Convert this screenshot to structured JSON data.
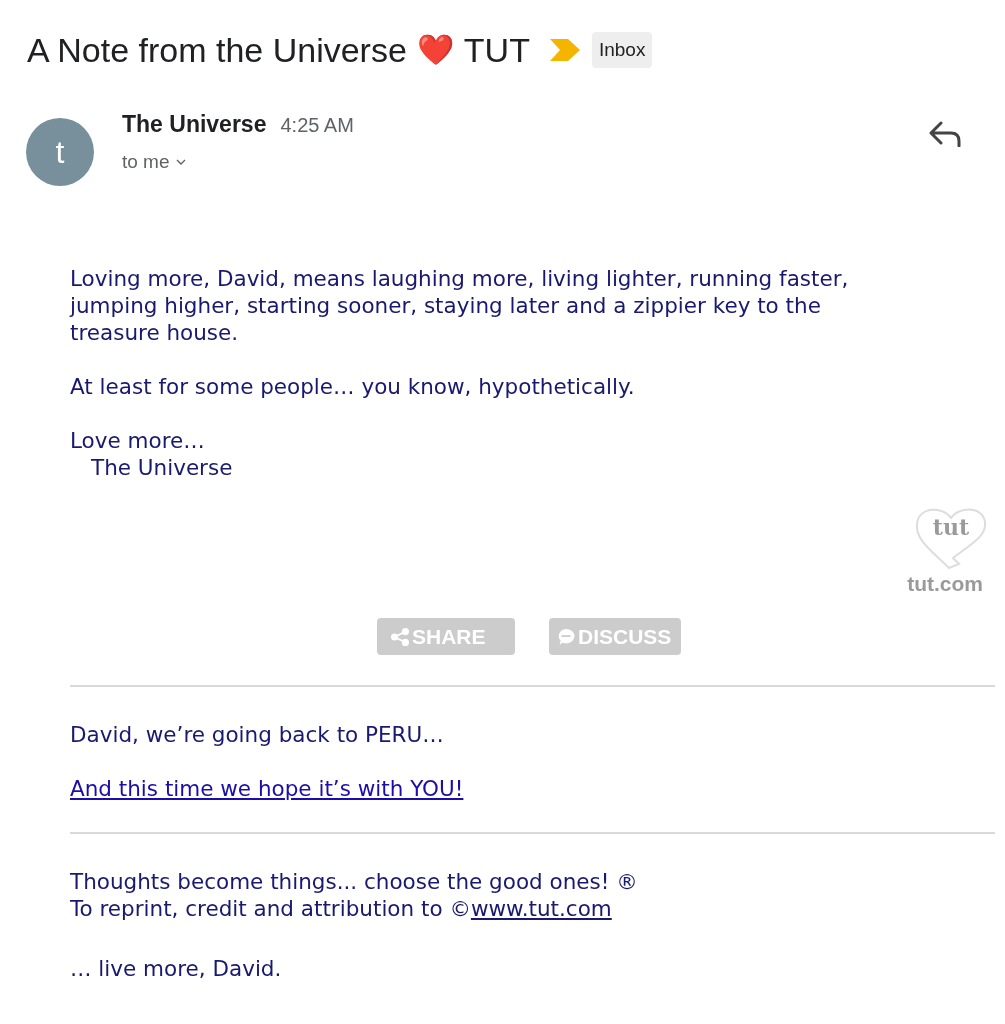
{
  "subject": {
    "title": "A Note from the Universe",
    "emoji": "❤️",
    "suffix": "TUT",
    "important": true,
    "label": "Inbox"
  },
  "message": {
    "avatar_letter": "t",
    "sender": "The Universe",
    "time": "4:25 AM",
    "recipient": "to me"
  },
  "body": {
    "paragraphs": [
      {
        "lines": [
          "Loving more, David, means laughing more, living lighter, running faster,",
          "jumping higher, starting sooner, staying later and a zippier key to the",
          "treasure house."
        ]
      },
      {
        "lines": [
          "At least for some people… you know, hypothetically."
        ]
      }
    ],
    "closing": "Love more…",
    "signature": "The Universe",
    "logo": {
      "mark": "tut",
      "caption": "tut.com"
    },
    "actions": [
      {
        "kind": "share",
        "label": "SHARE"
      },
      {
        "kind": "discuss",
        "label": "DISCUSS"
      }
    ],
    "promo": {
      "text": "David, we’re going back to PERU…",
      "link": "And this time we hope it’s with YOU!"
    },
    "footer": {
      "motto": "Thoughts become things... choose the good ones! ®",
      "reprint": "To reprint, credit and attribution to ©",
      "reprint_link": "www.tut.com",
      "signoff": "… live more, David."
    }
  }
}
